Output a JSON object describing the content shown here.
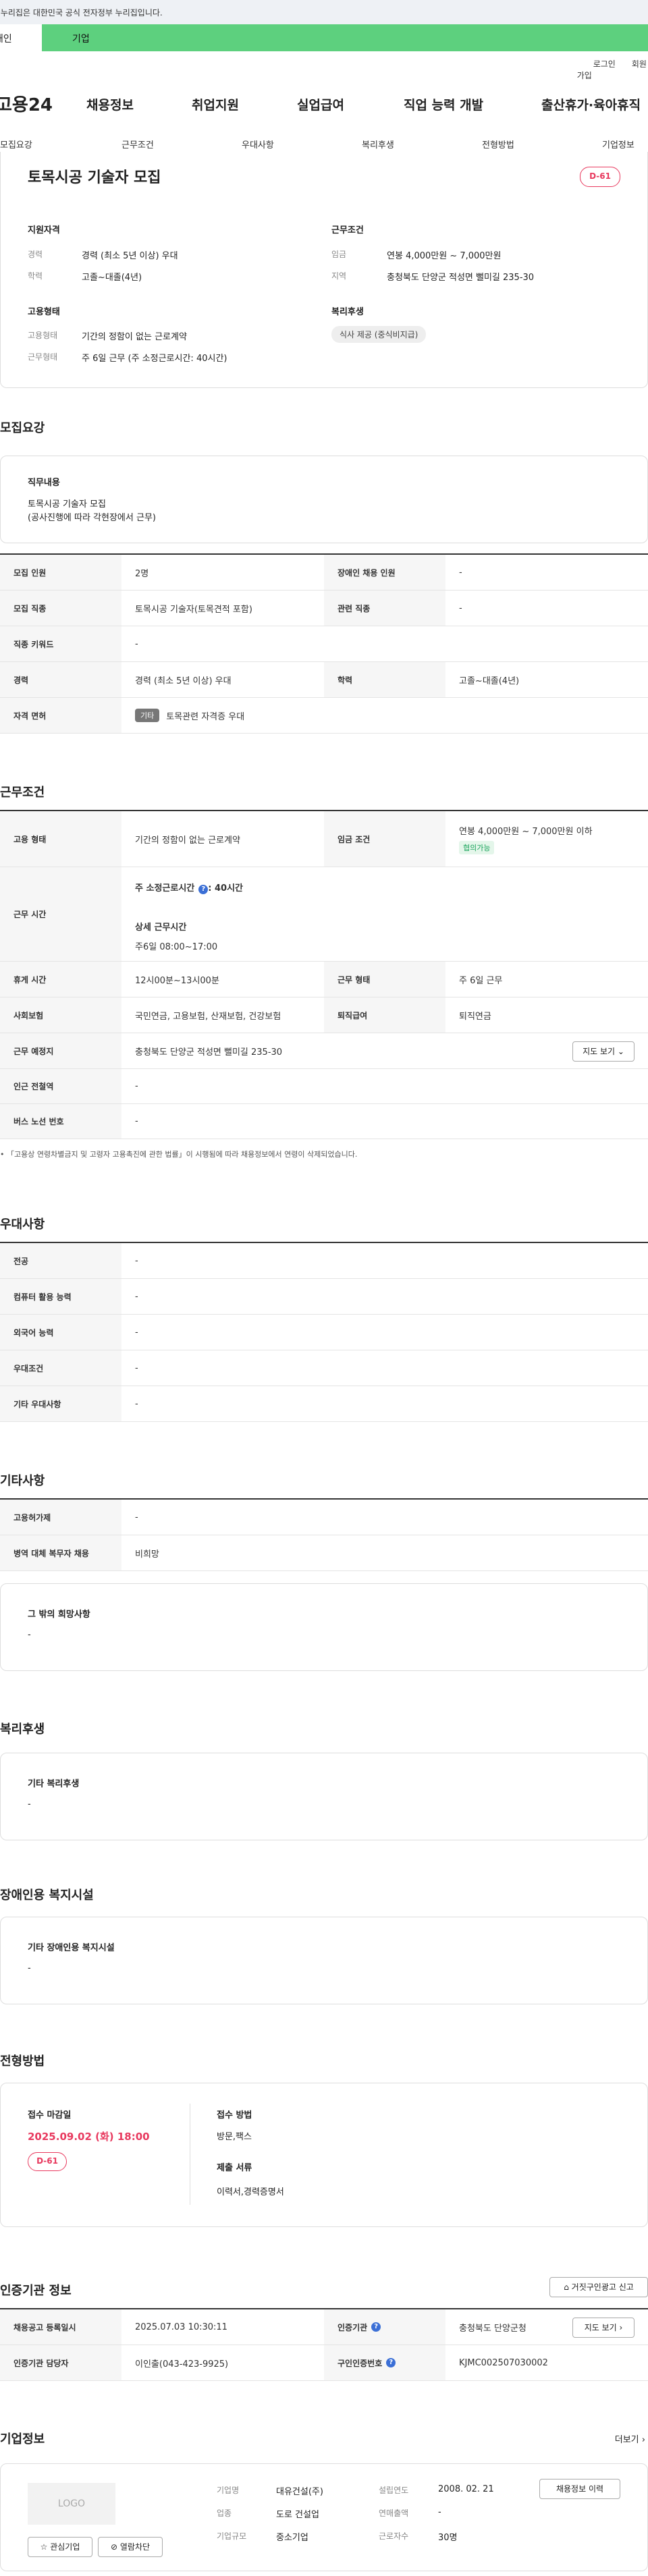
{
  "gov_notice": "이 누리집은 대한민국 공식 전자정부 누리집입니다.",
  "tabs": [
    "개인",
    "기업"
  ],
  "util": [
    "로그인",
    "회원가입"
  ],
  "logo": "고용24",
  "gnb": [
    "채용정보",
    "취업지원",
    "실업급여",
    "직업 능력 개발",
    "출산휴가·육아휴직"
  ],
  "subnav": [
    "모집요강",
    "근무조건",
    "우대사항",
    "복리후생",
    "전형방법",
    "기업정보"
  ],
  "summary": {
    "title": "토목시공 기술자 모집",
    "dday": "D-61",
    "qual_h": "지원자격",
    "career_l": "경력",
    "career_v": "경력 (최소 5년 이상) 우대",
    "edu_l": "학력",
    "edu_v": "고졸~대졸(4년)",
    "work_h": "근무조건",
    "wage_l": "임금",
    "wage_v": "연봉 4,000만원 ~ 7,000만원",
    "region_l": "지역",
    "region_v": "충청북도 단양군 적성면 뻘미길 235-30",
    "emp_h": "고용형태",
    "emptype_l": "고용형태",
    "emptype_v": "기간의 정함이 없는 근로계약",
    "worktype_l": "근무형태",
    "worktype_v": "주 6일 근무 (주 소정근로시간: 40시간)",
    "welfare_h": "복리후생",
    "welfare_chip": "식사 제공 (중식비지급)"
  },
  "recruit": {
    "title": "모집요강",
    "duty_h": "직무내용",
    "duty_v": "토목시공 기술자 모집\n(공사진행에 따라 각현장에서 근무)",
    "rows": [
      {
        "th": "모집 인원",
        "td": "2명",
        "th2": "장애인 채용 인원",
        "td2": "-"
      },
      {
        "th": "모집 직종",
        "td": "토목시공 기술자(토목견적 포함)",
        "th2": "관련 직종",
        "td2": "-"
      },
      {
        "th": "직종 키워드",
        "td": "-"
      },
      {
        "th": "경력",
        "td": "경력 (최소 5년 이상) 우대",
        "th2": "학력",
        "td2": "고졸~대졸(4년)"
      },
      {
        "th": "자격 면허",
        "tag": "기타",
        "td": "토목관련 자격증 우대"
      }
    ]
  },
  "cond": {
    "title": "근무조건",
    "emp_th": "고용 형태",
    "emp_td": "기간의 정함이 없는 근로계약",
    "wage_th": "임금 조건",
    "wage_td": "연봉 4,000만원 ~ 7,000만원 이하",
    "wage_tag": "협의가능",
    "time_th": "근무 시간",
    "time_a": "주 소정근로시간",
    "time_b": ": 40시간",
    "time_c": "상세 근무시간",
    "time_d": "주6일 08:00~17:00",
    "rest_th": "휴게 시간",
    "rest_td": "12시00분~13시00분",
    "form_th": "근무 형태",
    "form_td": "주 6일 근무",
    "ins_th": "사회보험",
    "ins_td": "국민연금, 고용보험, 산재보험, 건강보험",
    "ret_th": "퇴직급여",
    "ret_td": "퇴직연금",
    "place_th": "근무 예정지",
    "place_td": "충청북도 단양군 적성면 뻘미길 235-30",
    "map_btn": "지도 보기",
    "sub_th": "인근 전철역",
    "sub_td": "-",
    "bus_th": "버스 노선 번호",
    "bus_td": "-",
    "notice": "「고용상 연령차별금지 및 고령자 고용촉진에 관한 법률」이 시행됨에 따라 채용정보에서 연령이 삭제되었습니다."
  },
  "pref": {
    "title": "우대사항",
    "rows": [
      [
        "전공",
        "-"
      ],
      [
        "컴퓨터 활용 능력",
        "-"
      ],
      [
        "외국어 능력",
        "-"
      ],
      [
        "우대조건",
        "-"
      ],
      [
        "기타 우대사항",
        "-"
      ]
    ]
  },
  "etc": {
    "title": "기타사항",
    "rows": [
      [
        "고용허가제",
        "-"
      ],
      [
        "병역 대체 복무자 채용",
        "비희망"
      ]
    ],
    "box_h": "그 밖의 희망사항",
    "box_v": "-"
  },
  "welfare": {
    "title": "복리후생",
    "box_h": "기타 복리후생",
    "box_v": "-"
  },
  "disab": {
    "title": "장애인용 복지시설",
    "box_h": "기타 장애인용 복지시설",
    "box_v": "-"
  },
  "screen": {
    "title": "전형방법",
    "deadline_h": "접수 마감일",
    "deadline_v": "2025.09.02 (화) 18:00",
    "dday": "D-61",
    "method_h": "접수 방법",
    "method_v": "방문,팩스",
    "docs_h": "제출 서류",
    "docs_v": "이력서,경력증명서"
  },
  "agency": {
    "title": "인증기관 정보",
    "report_btn": "거짓구인광고 신고",
    "reg_th": "채용공고 등록일시",
    "reg_td": "2025.07.03 10:30:11",
    "org_th": "인증기관",
    "org_td": "충청북도 단양군청",
    "map_btn": "지도 보기",
    "mgr_th": "인증기관 담당자",
    "mgr_td": "이인출(043-423-9925)",
    "no_th": "구인인증번호",
    "no_td": "KJMC002507030002"
  },
  "company": {
    "title": "기업정보",
    "more": "더보기",
    "logo": "LOGO",
    "fav": "관심기업",
    "block": "열람차단",
    "name_l": "기업명",
    "name_v": "대유건설(주)",
    "ind_l": "업종",
    "ind_v": "도로 건설업",
    "size_l": "기업규모",
    "size_v": "중소기업",
    "est_l": "설립연도",
    "est_v": "2008. 02. 21",
    "sales_l": "연매출액",
    "sales_v": "-",
    "emp_l": "근로자수",
    "emp_v": "30명",
    "hist_btn": "채용정보 이력"
  }
}
